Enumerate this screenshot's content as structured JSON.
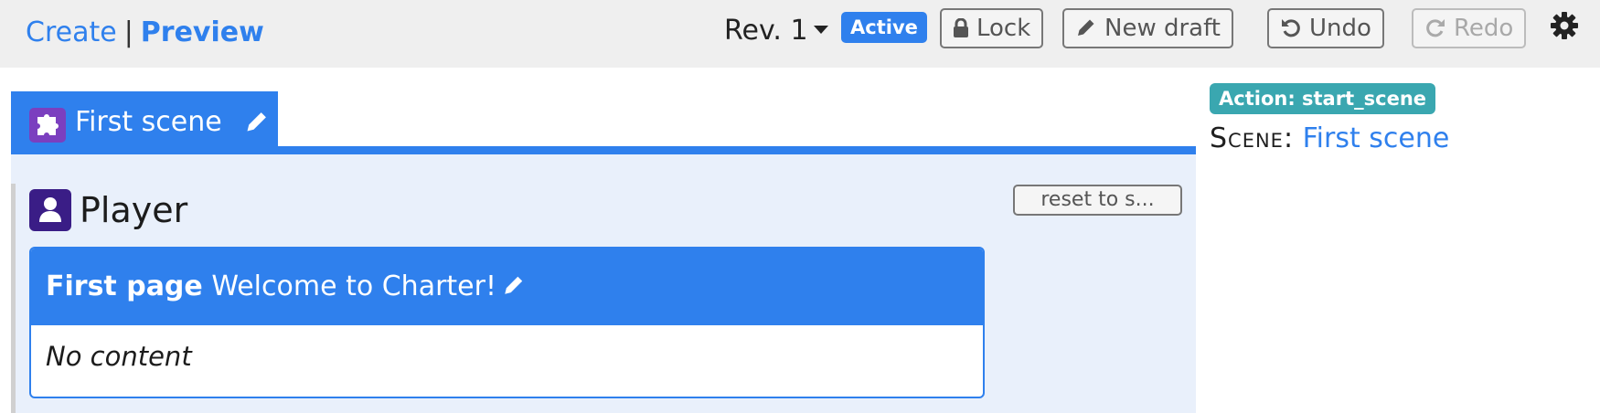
{
  "toolbar": {
    "create_label": "Create",
    "separator": "|",
    "preview_label": "Preview",
    "revision_label": "Rev. 1",
    "status_badge": "Active",
    "lock_label": "Lock",
    "new_draft_label": "New draft",
    "undo_label": "Undo",
    "redo_label": "Redo"
  },
  "scene_tab": {
    "label": "First scene"
  },
  "role": {
    "name": "Player",
    "reset_label": "reset to s..."
  },
  "page_card": {
    "title_bold": "First page",
    "title": "Welcome to Charter!",
    "body": "No content"
  },
  "sidebar": {
    "action_badge": "Action: start_scene",
    "scene_key": "Scene:",
    "scene_value": "First scene"
  },
  "colors": {
    "accent": "#2f80ed",
    "puzzle_icon": "#7b3fbf",
    "role_icon": "#3a1d86",
    "action_badge": "#3aa7b0"
  }
}
